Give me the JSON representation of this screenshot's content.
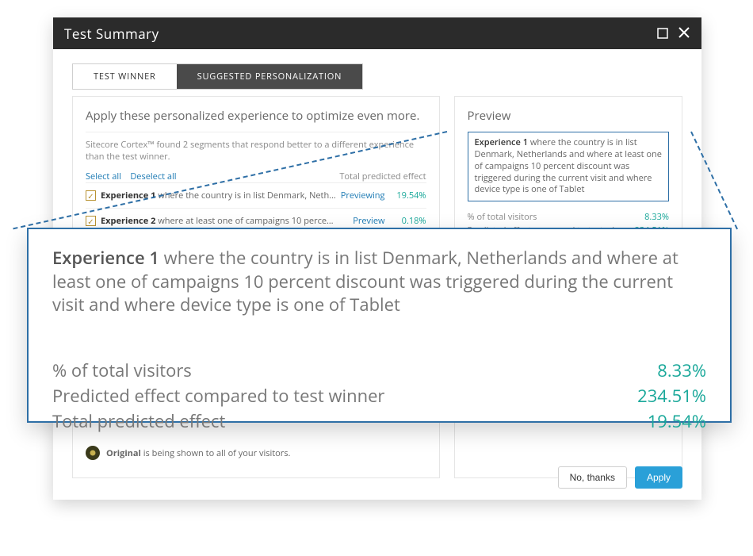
{
  "window": {
    "title": "Test Summary"
  },
  "tabs": {
    "winner": "TEST WINNER",
    "suggested": "SUGGESTED PERSONALIZATION"
  },
  "left": {
    "heading": "Apply these personalized experience to optimize even more.",
    "intro": "Sitecore Cortex™ found 2 segments that respond better to a different experience than the test winner.",
    "select_all": "Select all",
    "deselect_all": "Deselect all",
    "total_label": "Total predicted effect",
    "rows": [
      {
        "bold": "Experience 1",
        "rest": " where the country is in list Denmark, Neth…",
        "action": "Previewing",
        "pct": "19.54%"
      },
      {
        "bold": "Experience 2",
        "rest": " where at least one of campaigns 10 perce…",
        "action": "Preview",
        "pct": "0.18%"
      }
    ],
    "original_bold": "Original",
    "original_rest": " is being shown to all of your visitors."
  },
  "right": {
    "heading": "Preview",
    "desc_bold": "Experience 1",
    "desc_rest": " where the country is in list Denmark, Netherlands and where at least one of campaigns 10 percent discount was triggered during the current visit and where device type is one of Tablet",
    "stats": [
      {
        "label": "% of total visitors",
        "value": "8.33%"
      },
      {
        "label": "Predicted effect compared to test winner",
        "value": "234.51%"
      },
      {
        "label": "Total predicted effect",
        "value": "19.54%"
      }
    ]
  },
  "footer": {
    "no_thanks": "No, thanks",
    "apply": "Apply"
  },
  "zoom": {
    "desc_bold": "Experience 1",
    "desc_rest": " where the country is in list Denmark, Netherlands and where at least one of campaigns 10 percent discount was triggered during the current visit and where device type is one of Tablet",
    "metrics": [
      {
        "label": "% of total visitors",
        "value": "8.33%"
      },
      {
        "label": "Predicted effect compared to test winner",
        "value": "234.51%"
      },
      {
        "label": "Total predicted effect",
        "value": "19.54%"
      }
    ]
  }
}
